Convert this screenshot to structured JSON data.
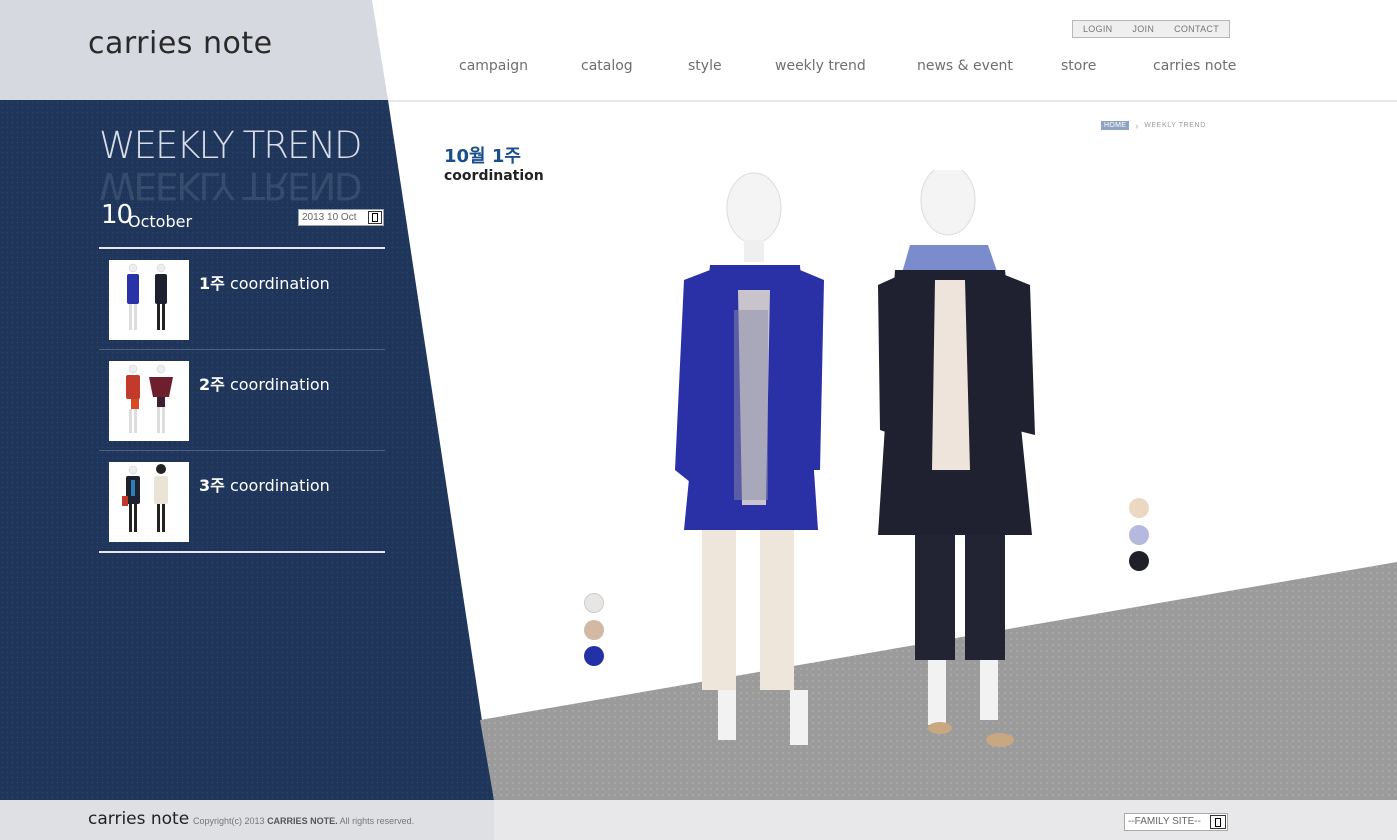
{
  "brand": {
    "logo": "carries note"
  },
  "utility_nav": [
    {
      "label": "LOGIN"
    },
    {
      "label": "JOIN"
    },
    {
      "label": "CONTACT"
    }
  ],
  "main_nav": [
    {
      "label": "campaign"
    },
    {
      "label": "catalog"
    },
    {
      "label": "style"
    },
    {
      "label": "weekly trend"
    },
    {
      "label": "news & event"
    },
    {
      "label": "store"
    },
    {
      "label": "carries note"
    }
  ],
  "sidebar": {
    "section_title": "WEEKLY TREND",
    "date_day": "10",
    "date_month": "October",
    "date_select_value": "2013 10 Oct",
    "items": [
      {
        "week": "1주",
        "label": "coordination"
      },
      {
        "week": "2주",
        "label": "coordination"
      },
      {
        "week": "3주",
        "label": "coordination"
      }
    ]
  },
  "breadcrumb": {
    "home": "HOME",
    "current": "WEEKLY TREND"
  },
  "content": {
    "title": "10월 1주",
    "subtitle": "coordination",
    "swatches_left": [
      "#e8e6e4",
      "#d2b9a4",
      "#2630a6"
    ],
    "swatches_right": [
      "#ecd7c2",
      "#b6b9de",
      "#1f2028"
    ]
  },
  "footer": {
    "logo": "carries note",
    "copyright_prefix": "Copyright(c) 2013",
    "copyright_brand": "CARRIES NOTE.",
    "copyright_suffix": "All rights reserved.",
    "family_site": "--FAMILY SITE--"
  },
  "colors": {
    "navy": "#1f355a",
    "header_grey": "#d7d9e0",
    "floor_grey": "#9c9c9c",
    "title_blue": "#1b4e8c"
  }
}
